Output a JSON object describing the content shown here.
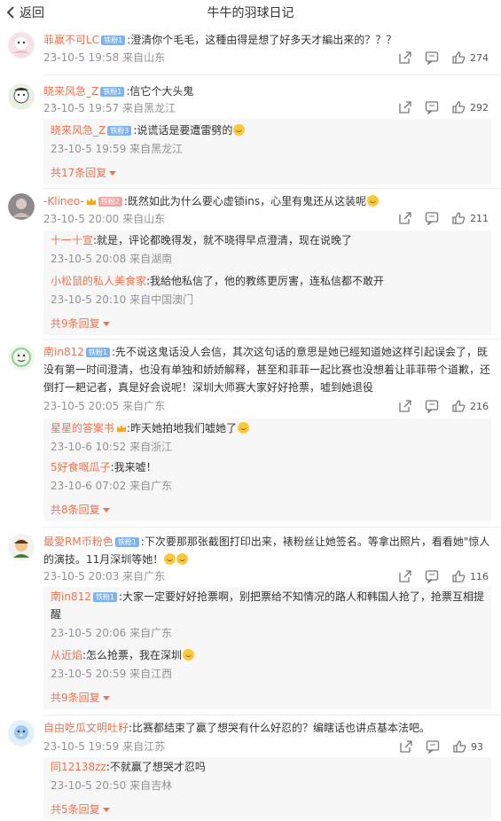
{
  "header": {
    "back_label": "返回",
    "title": "牛牛的羽球日记"
  },
  "comments": [
    {
      "user": "菲赢不可LC",
      "badge": "铁粉1",
      "text": ":澄清你个毛毛，这種由得是想了好多天才編出来的？？？",
      "time": "23-10-5 19:58",
      "location": "来自山东",
      "likes": "274"
    },
    {
      "user": "晓来风急_Z",
      "badge": "铁粉1",
      "text": ":信它个大头鬼",
      "time": "23-10-5 19:57",
      "location": "来自黑龙江",
      "likes": "292",
      "replies": [
        {
          "user": "晓来风急_Z",
          "badge": "铁粉3",
          "text": ":说谎话是要遭雷劈的",
          "time": "23-10-5 19:59",
          "location": "来自黑龙江"
        }
      ],
      "more": "共17条回复"
    },
    {
      "user": "-Klineo-",
      "badge": "铁粉2",
      "text": ":既然如此为什么要心虚锁ins，心里有鬼还从这装呢",
      "time": "23-10-5 20:00",
      "location": "来自山东",
      "likes": "211",
      "replies": [
        {
          "user": "十一十宣",
          "text": ":就是，评论都晚得发，就不晓得早点澄清，现在说晚了",
          "time": "23-10-5 20:08",
          "location": "来自湖南"
        },
        {
          "user": "小松鼠的私人美食家",
          "text": ":我給他私信了，他的教练更厉害，连私信都不敢开",
          "time": "23-10-5 20:10",
          "location": "来自中国澳门"
        }
      ],
      "more": "共9条回复"
    },
    {
      "user": "南in812",
      "badge": "铁粉1",
      "text_lines": [
        ":先不说这鬼话没人会信，其次这句话的意思是她已經知道她这样引起误会了，既",
        "没有第一时间澄清，也没有单独和娇娇解释，甚至和菲菲一起比赛也没想着让菲菲带个道歉，还",
        "倒打一耙记者，真是好会说呢！深圳大师赛大家好好抢票，嘘到她退役"
      ],
      "time": "23-10-5 20:05",
      "location": "来自广东",
      "likes": "216",
      "replies": [
        {
          "user": "星星的答案书",
          "text": ":昨天她拍地我们嘘她了",
          "time": "23-10-6 10:52",
          "location": "来自浙江"
        },
        {
          "user": "5好食嘅瓜子",
          "text": ":我来嘘！",
          "time": "23-10-6 07:02",
          "location": "来自广东"
        }
      ],
      "more": "共8条回复"
    },
    {
      "user": "最愛RM币粉色",
      "badge": "铁粉1",
      "text_lines": [
        ":下次要那那张截图打印出来，裱粉丝让她签名。等拿出照片，看看她\"惊人",
        "的演技。11月深圳等她！"
      ],
      "time": "23-10-5 20:03",
      "location": "来自广东",
      "likes": "116",
      "replies": [
        {
          "user": "南in812",
          "badge": "铁粉1",
          "text_lines": [
            ":大家一定要好好抢票啊，别把票给不知情况的路人和韩国人抢了，抢票互相提",
            "醒"
          ],
          "time": "23-10-5 20:06",
          "location": "来自广东"
        },
        {
          "user": "从近焰",
          "text": ":怎么抢票，我在深圳",
          "time": "23-10-5 20:59",
          "location": "来自江西"
        }
      ],
      "more": "共9条回复"
    },
    {
      "user": "自由吃瓜文明吐籽",
      "text": ":比赛都结束了赢了想哭有什么好忍的？编瞎话也讲点基本法吧。",
      "time": "23-10-5 19:59",
      "location": "来自江苏",
      "likes": "93",
      "replies": [
        {
          "user": "同12138zz",
          "text": ":不就赢了想哭才忍吗",
          "time": "23-10-5 20:50",
          "location": "来自吉林"
        }
      ],
      "more": "共5条回复"
    }
  ],
  "colors": {
    "username": "#eb7350",
    "meta": "#939393",
    "badge": "#7fb3f0"
  },
  "icons": [
    "chevron-left-icon",
    "share-icon",
    "comment-icon",
    "like-icon",
    "crown-icon",
    "emoji-icon"
  ]
}
